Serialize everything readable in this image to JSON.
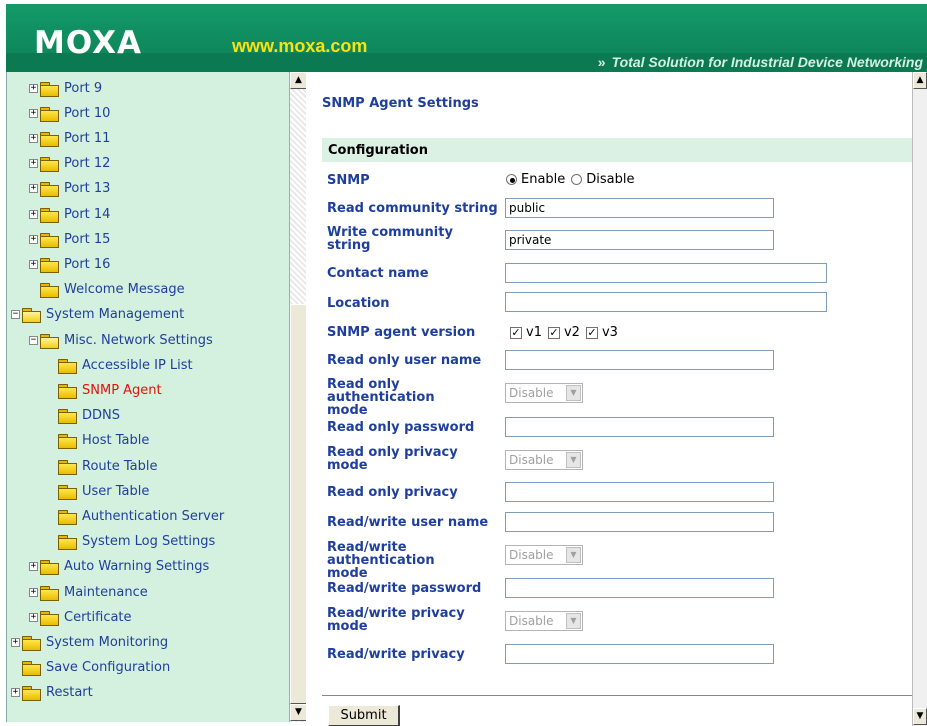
{
  "header": {
    "logo": "MOXA",
    "url": "www.moxa.com",
    "tagline_arrows": "»",
    "tagline": "Total Solution for Industrial Device Networking"
  },
  "tree": {
    "items": [
      {
        "label": "Port 9",
        "toggle": "+",
        "folder": "closed"
      },
      {
        "label": "Port 10",
        "toggle": "+",
        "folder": "closed"
      },
      {
        "label": "Port 11",
        "toggle": "+",
        "folder": "closed"
      },
      {
        "label": "Port 12",
        "toggle": "+",
        "folder": "closed"
      },
      {
        "label": "Port 13",
        "toggle": "+",
        "folder": "closed"
      },
      {
        "label": "Port 14",
        "toggle": "+",
        "folder": "closed"
      },
      {
        "label": "Port 15",
        "toggle": "+",
        "folder": "closed"
      },
      {
        "label": "Port 16",
        "toggle": "+",
        "folder": "closed"
      },
      {
        "label": "Welcome Message",
        "toggle": "",
        "folder": "closed"
      },
      {
        "label": "System Management",
        "toggle": "−",
        "folder": "open"
      },
      {
        "label": "Misc. Network Settings",
        "toggle": "−",
        "folder": "open"
      },
      {
        "label": "Accessible IP List",
        "toggle": "",
        "folder": "closed"
      },
      {
        "label": "SNMP Agent",
        "toggle": "",
        "folder": "closed",
        "active": true
      },
      {
        "label": "DDNS",
        "toggle": "",
        "folder": "closed"
      },
      {
        "label": "Host Table",
        "toggle": "",
        "folder": "closed"
      },
      {
        "label": "Route Table",
        "toggle": "",
        "folder": "closed"
      },
      {
        "label": "User Table",
        "toggle": "",
        "folder": "closed"
      },
      {
        "label": "Authentication Server",
        "toggle": "",
        "folder": "closed"
      },
      {
        "label": "System Log Settings",
        "toggle": "",
        "folder": "closed"
      },
      {
        "label": "Auto Warning Settings",
        "toggle": "+",
        "folder": "closed"
      },
      {
        "label": "Maintenance",
        "toggle": "+",
        "folder": "closed"
      },
      {
        "label": "Certificate",
        "toggle": "+",
        "folder": "closed"
      },
      {
        "label": "System Monitoring",
        "toggle": "+",
        "folder": "closed"
      },
      {
        "label": "Save Configuration",
        "toggle": "",
        "folder": "closed"
      },
      {
        "label": "Restart",
        "toggle": "+",
        "folder": "closed"
      }
    ]
  },
  "page": {
    "title": "SNMP Agent Settings",
    "section": "Configuration",
    "submit_label": "Submit"
  },
  "form": {
    "snmp": {
      "label": "SNMP",
      "options": [
        "Enable",
        "Disable"
      ],
      "selected": "Enable"
    },
    "read_community": {
      "label": "Read community string",
      "value": "public"
    },
    "write_community": {
      "label": "Write community string",
      "value": "private"
    },
    "contact_name": {
      "label": "Contact name",
      "value": ""
    },
    "location": {
      "label": "Location",
      "value": ""
    },
    "agent_version": {
      "label": "SNMP agent version",
      "options": [
        {
          "label": "v1",
          "checked": true
        },
        {
          "label": "v2",
          "checked": true
        },
        {
          "label": "v3",
          "checked": true
        }
      ]
    },
    "ro_user": {
      "label": "Read only user name",
      "value": ""
    },
    "ro_auth_mode": {
      "label": "Read only authentication mode",
      "value": "Disable"
    },
    "ro_password": {
      "label": "Read only password",
      "value": ""
    },
    "ro_privacy_mode": {
      "label": "Read only privacy mode",
      "value": "Disable"
    },
    "ro_privacy": {
      "label": "Read only privacy",
      "value": ""
    },
    "rw_user": {
      "label": "Read/write user name",
      "value": ""
    },
    "rw_auth_mode": {
      "label": "Read/write authentication mode",
      "value": "Disable"
    },
    "rw_password": {
      "label": "Read/write password",
      "value": ""
    },
    "rw_privacy_mode": {
      "label": "Read/write privacy mode",
      "value": "Disable"
    },
    "rw_privacy": {
      "label": "Read/write privacy",
      "value": ""
    }
  },
  "scroll_glyphs": {
    "up": "▲",
    "down": "▼"
  }
}
